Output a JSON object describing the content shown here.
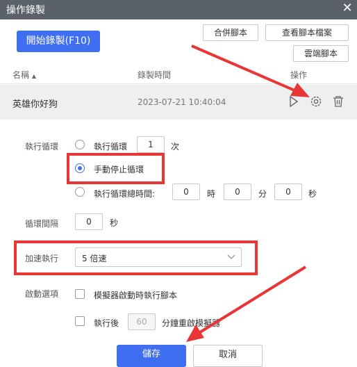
{
  "window": {
    "title": "操作錄製",
    "close_icon": "close-icon"
  },
  "toolbar": {
    "start_label": "開始錄製(F10)",
    "merge_label": "合併腳本",
    "view_label": "查看腳本檔案",
    "cloud_label": "雲端腳本"
  },
  "table": {
    "headers": {
      "name": "名稱",
      "time": "錄製時間",
      "action": "操作"
    },
    "rows": [
      {
        "name": "英雄你好狗",
        "time": "2023-07-21 10:40:04"
      }
    ]
  },
  "settings": {
    "loop_label": "執行循環",
    "loop_count_label": "執行循環",
    "loop_count_value": "1",
    "loop_count_unit": "次",
    "manual_stop_label": "手動停止循環",
    "total_time_label": "執行循環總時間:",
    "hours_value": "0",
    "hours_unit": "時",
    "minutes_value": "0",
    "minutes_unit": "分",
    "seconds_value": "0",
    "seconds_unit": "秒",
    "interval_label": "循環間隔",
    "interval_value": "0",
    "interval_unit": "秒",
    "speed_label": "加速執行",
    "speed_value": "5 倍速",
    "startup_label": "啟動選項",
    "startup_option1": "模擬器啟動時執行腳本",
    "startup_option2_pre": "執行後",
    "startup_option2_value": "60",
    "startup_option2_post": "分鐘重啟模擬器"
  },
  "footer": {
    "save_label": "儲存",
    "cancel_label": "取消"
  },
  "colors": {
    "accent": "#3f6ff0",
    "highlight": "#e83535",
    "titlebar": "#5b6169"
  }
}
